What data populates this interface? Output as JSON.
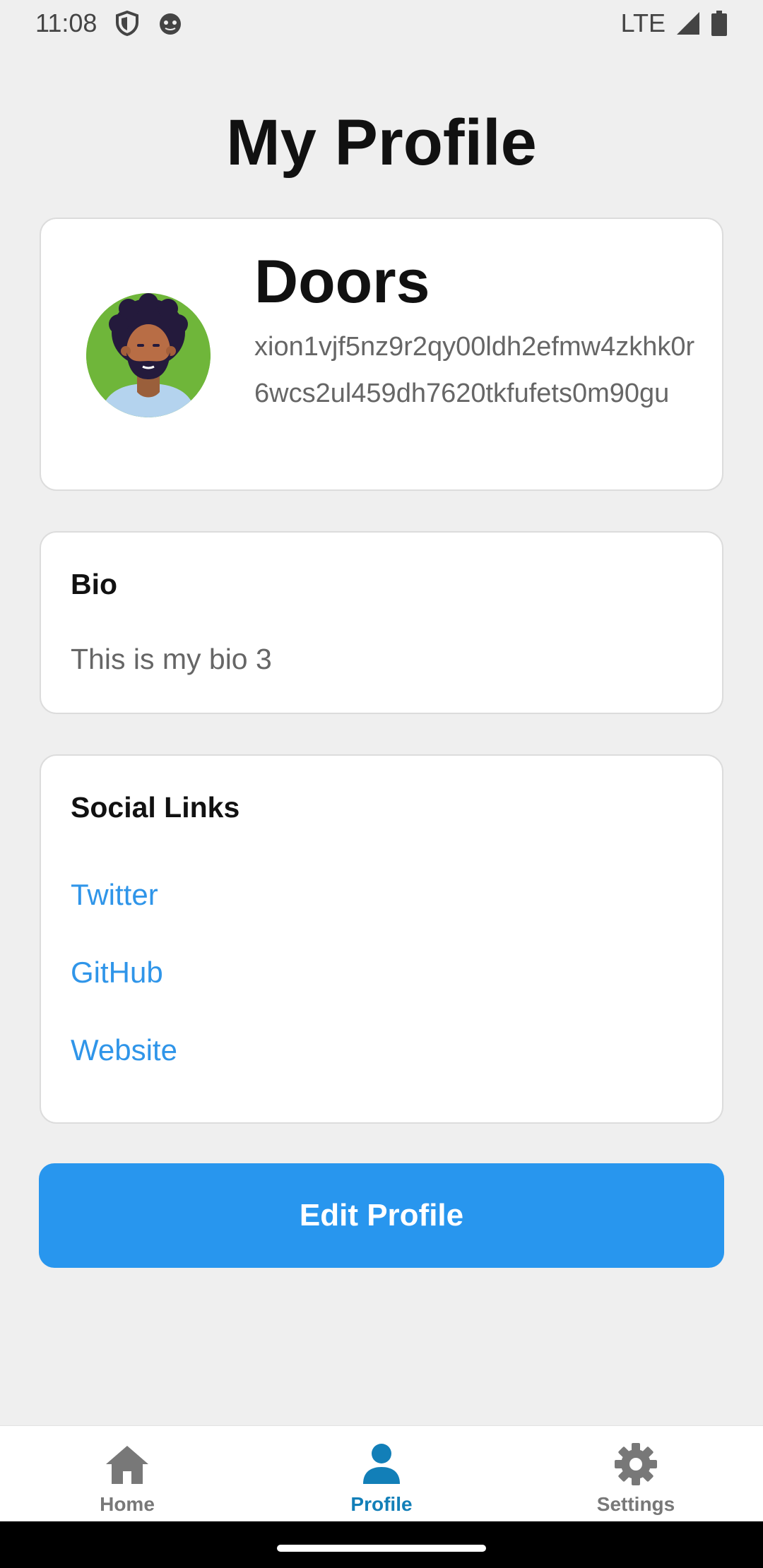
{
  "status_bar": {
    "time": "11:08",
    "network": "LTE",
    "icons": [
      "shield-icon",
      "face-icon",
      "signal-icon",
      "battery-icon"
    ]
  },
  "page": {
    "title": "My Profile"
  },
  "profile": {
    "name": "Doors",
    "address": "xion1vjf5nz9r2qy00ldh2efmw4zkhk0r6wcs2ul459dh7620tkfufets0m90gu",
    "avatar_icon": "avatar-illustration"
  },
  "bio": {
    "heading": "Bio",
    "text": "This is my bio 3"
  },
  "social": {
    "heading": "Social Links",
    "links": [
      {
        "label": "Twitter"
      },
      {
        "label": "GitHub"
      },
      {
        "label": "Website"
      }
    ]
  },
  "actions": {
    "edit_label": "Edit Profile"
  },
  "bottom_nav": {
    "items": [
      {
        "label": "Home",
        "icon": "home-icon",
        "active": false
      },
      {
        "label": "Profile",
        "icon": "person-icon",
        "active": true
      },
      {
        "label": "Settings",
        "icon": "gear-icon",
        "active": false
      }
    ]
  },
  "colors": {
    "accent": "#2896ee",
    "link": "#2f95e9",
    "nav_active": "#127fb8",
    "nav_inactive": "#787878",
    "background": "#efefef"
  }
}
